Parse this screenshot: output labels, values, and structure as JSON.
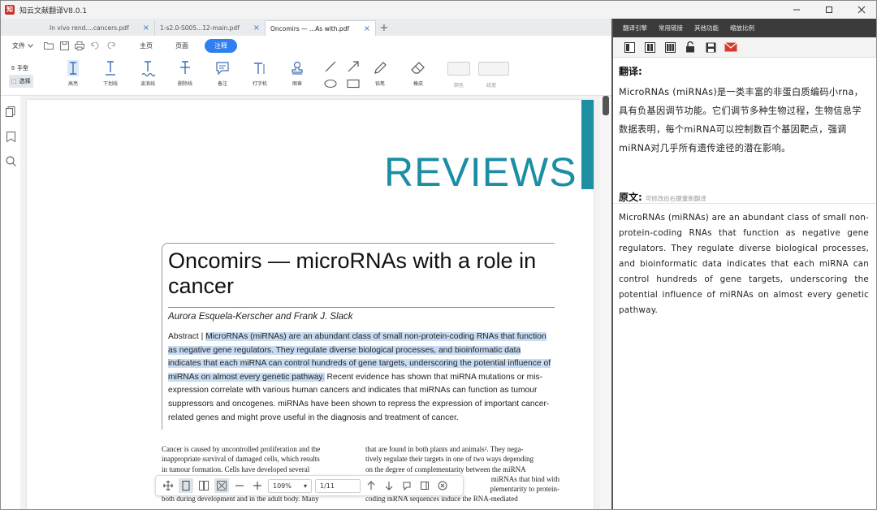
{
  "app": {
    "title": "知云文献翻译V8.0.1",
    "logo_text": "知"
  },
  "tabs": [
    {
      "label": "In vivo rend....cancers.pdf",
      "close": "×"
    },
    {
      "label": "1-s2.0-S005...12-main.pdf",
      "close": "×"
    },
    {
      "label": "Oncomirs — ...As with.pdf",
      "close": "×"
    }
  ],
  "tab_add": "+",
  "menu": {
    "file_label": "文件",
    "modes": [
      "主页",
      "页面",
      "注释"
    ],
    "active_mode": "注释"
  },
  "toolbar": {
    "hand_label": "手型",
    "select_label": "选择",
    "tools": [
      "高亮",
      "下划线",
      "波浪线",
      "删除线",
      "备注",
      "打字机",
      "图章",
      "铅笔",
      "橡皮"
    ],
    "color_label": "颜色",
    "linewidth_label": "线宽"
  },
  "document": {
    "header": "REVIEWS",
    "title": "Oncomirs — microRNAs with a role in cancer",
    "authors": "Aurora Esquela-Kerscher and Frank J. Slack",
    "abstract_label": "Abstract |",
    "abstract_highlighted": "MicroRNAs (miRNAs) are an abundant class of small non-protein-coding RNAs that function as negative gene regulators. They regulate diverse biological processes, and bioinformatic data indicates that each miRNA can control hundreds of gene targets, underscoring the potential influence of miRNAs on almost every genetic pathway.",
    "abstract_rest": "Recent evidence has shown that miRNA mutations or mis-expression correlate with various human cancers and indicates that miRNAs can function as tumour suppressors and oncogenes. miRNAs have been shown to repress the expression of important cancer-related genes and might prove useful in the diagnosis and treatment of cancer.",
    "col1_lines": [
      "Cancer is caused by uncontrolled proliferation and the",
      "inappropriate survival of damaged cells, which results",
      "in tumour formation. Cells have developed several",
      "",
      "",
      "both during development and in the adult body. Many"
    ],
    "col2_lines": [
      "that are found in both plants and animals². They nega-",
      "tively regulate their targets in one of two ways depending",
      "on the degree of complementarity between the miRNA",
      "miRNAs that bind with",
      "plementarity to protein-",
      "coding mRNA sequences induce the RNA-mediated"
    ]
  },
  "floatbar": {
    "zoom": "109%",
    "zoom_caret": "▾",
    "page": "1/11"
  },
  "right_panel": {
    "menus": [
      "翻译引擎",
      "常用链接",
      "其他功能",
      "缩放比例"
    ],
    "translation_heading": "翻译:",
    "translation_text": "MicroRNAs (miRNAs)是一类丰富的非蛋白质编码小rna，具有负基因调节功能。它们调节多种生物过程，生物信息学数据表明，每个miRNA可以控制数百个基因靶点，强调miRNA对几乎所有遗传途径的潜在影响。",
    "original_heading": "原文:",
    "original_hint": "可修改后右键重新翻译",
    "original_text": "MicroRNAs (miRNAs) are an abundant class of small non-protein-coding RNAs that function as negative gene regulators. They regulate diverse biological processes, and bioinformatic data indicates that each miRNA can control hundreds of gene targets, underscoring the potential influence of miRNAs on almost every genetic pathway."
  },
  "colors": {
    "accent": "#2f7ff0",
    "teal": "#1b8ea3",
    "highlight": "#c7dcf2",
    "mail_icon": "#d43b2f"
  }
}
